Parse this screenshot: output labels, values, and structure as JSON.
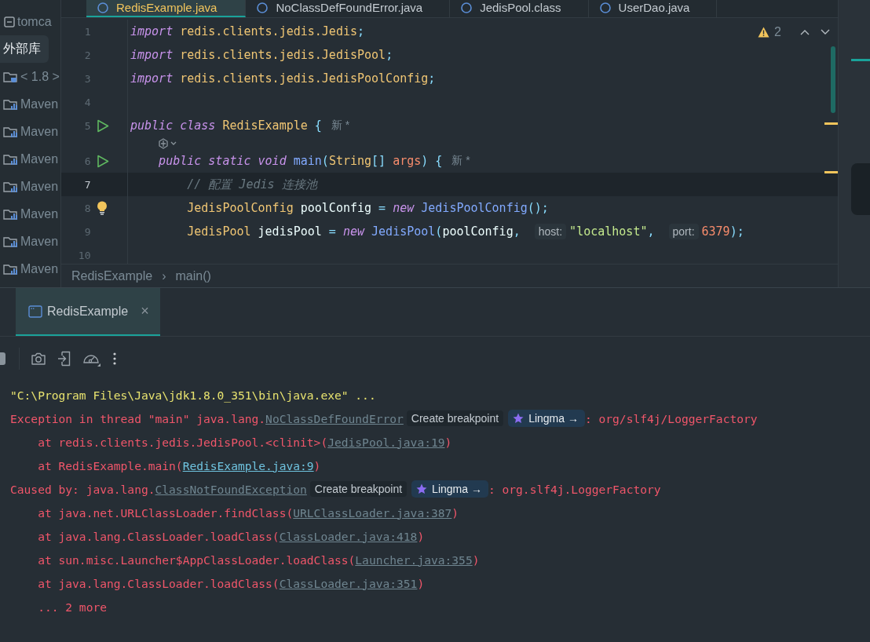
{
  "sidebar": {
    "items": [
      {
        "label": "tomca",
        "kind": "file",
        "selected": false
      },
      {
        "label": "外部库",
        "kind": "none",
        "selected": true
      },
      {
        "label": "< 1.8 >",
        "kind": "jdk",
        "selected": false
      },
      {
        "label": "Maven",
        "kind": "maven",
        "selected": false
      },
      {
        "label": "Maven",
        "kind": "maven",
        "selected": false
      },
      {
        "label": "Maven",
        "kind": "maven",
        "selected": false
      },
      {
        "label": "Maven",
        "kind": "maven",
        "selected": false
      },
      {
        "label": "Maven",
        "kind": "maven",
        "selected": false
      },
      {
        "label": "Maven",
        "kind": "maven",
        "selected": false
      },
      {
        "label": "Maven",
        "kind": "maven",
        "selected": false
      }
    ]
  },
  "editor": {
    "tabs": [
      {
        "label": "RedisExample.java",
        "selected": true
      },
      {
        "label": "NoClassDefFoundError.java",
        "selected": false
      },
      {
        "label": "JedisPool.class",
        "selected": false
      },
      {
        "label": "UserDao.java",
        "selected": false
      }
    ],
    "problems": {
      "count": "2"
    },
    "lines": [
      {
        "kind": "code",
        "number": "1",
        "run_marker": false,
        "bulb": false,
        "current": false,
        "tokens": [
          {
            "kind": "keyword",
            "text": "import"
          },
          {
            "kind": "type",
            "text": " redis.clients.jedis.Jedis"
          },
          {
            "kind": "punct",
            "text": ";"
          }
        ]
      },
      {
        "kind": "code",
        "number": "2",
        "run_marker": false,
        "bulb": false,
        "current": false,
        "tokens": [
          {
            "kind": "keyword",
            "text": "import"
          },
          {
            "kind": "type",
            "text": " redis.clients.jedis.JedisPool"
          },
          {
            "kind": "punct",
            "text": ";"
          }
        ]
      },
      {
        "kind": "code",
        "number": "3",
        "run_marker": false,
        "bulb": false,
        "current": false,
        "tokens": [
          {
            "kind": "keyword",
            "text": "import"
          },
          {
            "kind": "type",
            "text": " redis.clients.jedis.JedisPoolConfig"
          },
          {
            "kind": "punct",
            "text": ";"
          }
        ]
      },
      {
        "kind": "code",
        "number": "4",
        "run_marker": false,
        "bulb": false,
        "current": false
      },
      {
        "kind": "code",
        "number": "5",
        "run_marker": true,
        "bulb": false,
        "current": false,
        "tokens": [
          {
            "kind": "keyword",
            "text": "public class"
          },
          {
            "kind": "type",
            "text": " RedisExample"
          },
          {
            "kind": "punct",
            "text": " {"
          },
          {
            "kind": "note",
            "text": "新 *"
          }
        ]
      },
      {
        "kind": "lens"
      },
      {
        "kind": "code",
        "number": "6",
        "run_marker": true,
        "bulb": false,
        "current": false,
        "tokens": [
          {
            "kind": "keyword",
            "text": "    public static void"
          },
          {
            "kind": "method",
            "text": " main"
          },
          {
            "kind": "punct",
            "text": "("
          },
          {
            "kind": "type",
            "text": "String"
          },
          {
            "kind": "punct",
            "text": "[]"
          },
          {
            "kind": "param",
            "text": " args"
          },
          {
            "kind": "punct",
            "text": ") {"
          },
          {
            "kind": "note",
            "text": "新 *"
          }
        ]
      },
      {
        "kind": "code",
        "number": "7",
        "run_marker": false,
        "bulb": false,
        "current": true,
        "tokens": [
          {
            "kind": "comment",
            "text": "        // 配置 Jedis 连接池"
          }
        ]
      },
      {
        "kind": "code",
        "number": "8",
        "run_marker": false,
        "bulb": true,
        "current": false,
        "tokens": [
          {
            "kind": "type",
            "text": "        JedisPoolConfig"
          },
          {
            "kind": "plain",
            "text": " poolConfig"
          },
          {
            "kind": "punct",
            "text": " = "
          },
          {
            "kind": "keyword",
            "text": "new"
          },
          {
            "kind": "method",
            "text": " JedisPoolConfig"
          },
          {
            "kind": "punct",
            "text": "();"
          }
        ]
      },
      {
        "kind": "code",
        "number": "9",
        "run_marker": false,
        "bulb": false,
        "current": false,
        "tokens": [
          {
            "kind": "type",
            "text": "        JedisPool"
          },
          {
            "kind": "plain",
            "text": " jedisPool"
          },
          {
            "kind": "punct",
            "text": " = "
          },
          {
            "kind": "keyword",
            "text": "new"
          },
          {
            "kind": "method",
            "text": " JedisPool"
          },
          {
            "kind": "punct",
            "text": "("
          },
          {
            "kind": "plain",
            "text": "poolConfig"
          },
          {
            "kind": "punct",
            "text": ", "
          },
          {
            "kind": "hint",
            "text": "host:"
          },
          {
            "kind": "string",
            "text": "\"localhost\""
          },
          {
            "kind": "punct",
            "text": ", "
          },
          {
            "kind": "hint",
            "text": "port:"
          },
          {
            "kind": "number",
            "text": "6379"
          },
          {
            "kind": "punct",
            "text": ");"
          }
        ]
      },
      {
        "kind": "code",
        "number": "10",
        "run_marker": false,
        "bulb": false,
        "current": false
      }
    ],
    "breadcrumb": {
      "items": [
        "RedisExample",
        "main()"
      ],
      "separator": "›"
    }
  },
  "run_panel": {
    "tabs": [
      {
        "label": "RedisExample",
        "selected": true,
        "close": "×"
      }
    ],
    "console": [
      [
        {
          "kind": "cmd",
          "text": "\"C:\\Program Files\\Java\\jdk1.8.0_351\\bin\\java.exe\" ..."
        }
      ],
      [
        {
          "kind": "error",
          "text": "Exception in thread \"main\" java.lang."
        },
        {
          "kind": "link",
          "text": "NoClassDefFoundError"
        },
        {
          "kind": "chip",
          "text": "Create breakpoint"
        },
        {
          "kind": "lingma",
          "text": "Lingma →"
        },
        {
          "kind": "error",
          "text": ": org/slf4j/LoggerFactory"
        }
      ],
      [
        {
          "kind": "error",
          "text": "    at redis.clients.jedis.JedisPool.<clinit>("
        },
        {
          "kind": "link",
          "text": "JedisPool.java:19"
        },
        {
          "kind": "error",
          "text": ")"
        }
      ],
      [
        {
          "kind": "error",
          "text": "    at RedisExample.main("
        },
        {
          "kind": "link-active",
          "text": "RedisExample.java:9"
        },
        {
          "kind": "error",
          "text": ")"
        }
      ],
      [
        {
          "kind": "error",
          "text": "Caused by: java.lang."
        },
        {
          "kind": "link",
          "text": "ClassNotFoundException"
        },
        {
          "kind": "chip",
          "text": "Create breakpoint"
        },
        {
          "kind": "lingma",
          "text": "Lingma →"
        },
        {
          "kind": "error",
          "text": ": org.slf4j.LoggerFactory"
        }
      ],
      [
        {
          "kind": "error",
          "text": "    at java.net.URLClassLoader.findClass("
        },
        {
          "kind": "link",
          "text": "URLClassLoader.java:387"
        },
        {
          "kind": "error",
          "text": ")"
        }
      ],
      [
        {
          "kind": "error",
          "text": "    at java.lang.ClassLoader.loadClass("
        },
        {
          "kind": "link",
          "text": "ClassLoader.java:418"
        },
        {
          "kind": "error",
          "text": ")"
        }
      ],
      [
        {
          "kind": "error",
          "text": "    at sun.misc.Launcher$AppClassLoader.loadClass("
        },
        {
          "kind": "link",
          "text": "Launcher.java:355"
        },
        {
          "kind": "error",
          "text": ")"
        }
      ],
      [
        {
          "kind": "error",
          "text": "    at java.lang.ClassLoader.loadClass("
        },
        {
          "kind": "link",
          "text": "ClassLoader.java:351"
        },
        {
          "kind": "error",
          "text": ")"
        }
      ],
      [
        {
          "kind": "error",
          "text": "    ... 2 more"
        }
      ]
    ]
  }
}
